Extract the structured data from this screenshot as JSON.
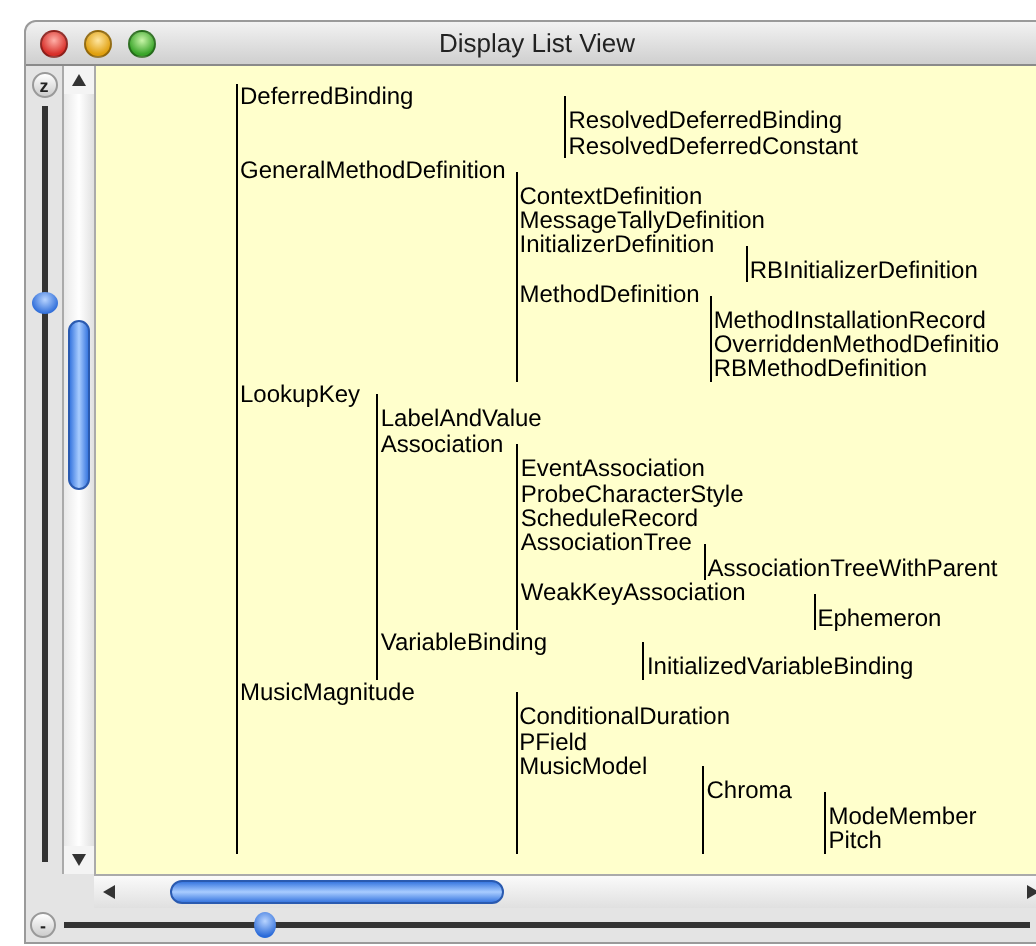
{
  "window": {
    "title": "Display List View"
  },
  "zoom_slider": {
    "label": "z",
    "level": 0.75
  },
  "zoom_out_button": {
    "label": "-"
  },
  "bottom_slider": {
    "level": 0.2
  },
  "tree": [
    {
      "label": "DeferredBinding",
      "children": [
        {
          "label": "ResolvedDeferredBinding"
        },
        {
          "label": "ResolvedDeferredConstant"
        }
      ]
    },
    {
      "label": "GeneralMethodDefinition",
      "children": [
        {
          "label": "ContextDefinition"
        },
        {
          "label": "MessageTallyDefinition"
        },
        {
          "label": "InitializerDefinition",
          "children": [
            {
              "label": "RBInitializerDefinition"
            }
          ]
        },
        {
          "label": "MethodDefinition",
          "children": [
            {
              "label": "MethodInstallationRecord"
            },
            {
              "label": "OverriddenMethodDefinitio"
            },
            {
              "label": "RBMethodDefinition"
            }
          ]
        }
      ]
    },
    {
      "label": "LookupKey",
      "children": [
        {
          "label": "LabelAndValue"
        },
        {
          "label": "Association",
          "children": [
            {
              "label": "EventAssociation"
            },
            {
              "label": "ProbeCharacterStyle"
            },
            {
              "label": "ScheduleRecord"
            },
            {
              "label": "AssociationTree",
              "children": [
                {
                  "label": "AssociationTreeWithParent"
                }
              ]
            },
            {
              "label": "WeakKeyAssociation",
              "children": [
                {
                  "label": "Ephemeron"
                }
              ]
            }
          ]
        },
        {
          "label": "VariableBinding",
          "children": [
            {
              "label": "InitializedVariableBinding"
            }
          ]
        }
      ]
    },
    {
      "label": "MusicMagnitude",
      "children": [
        {
          "label": "ConditionalDuration"
        },
        {
          "label": "PField"
        },
        {
          "label": "MusicModel",
          "children": [
            {
              "label": "Chroma",
              "children": [
                {
                  "label": "ModeMember"
                },
                {
                  "label": "Pitch"
                }
              ]
            }
          ]
        }
      ]
    }
  ]
}
